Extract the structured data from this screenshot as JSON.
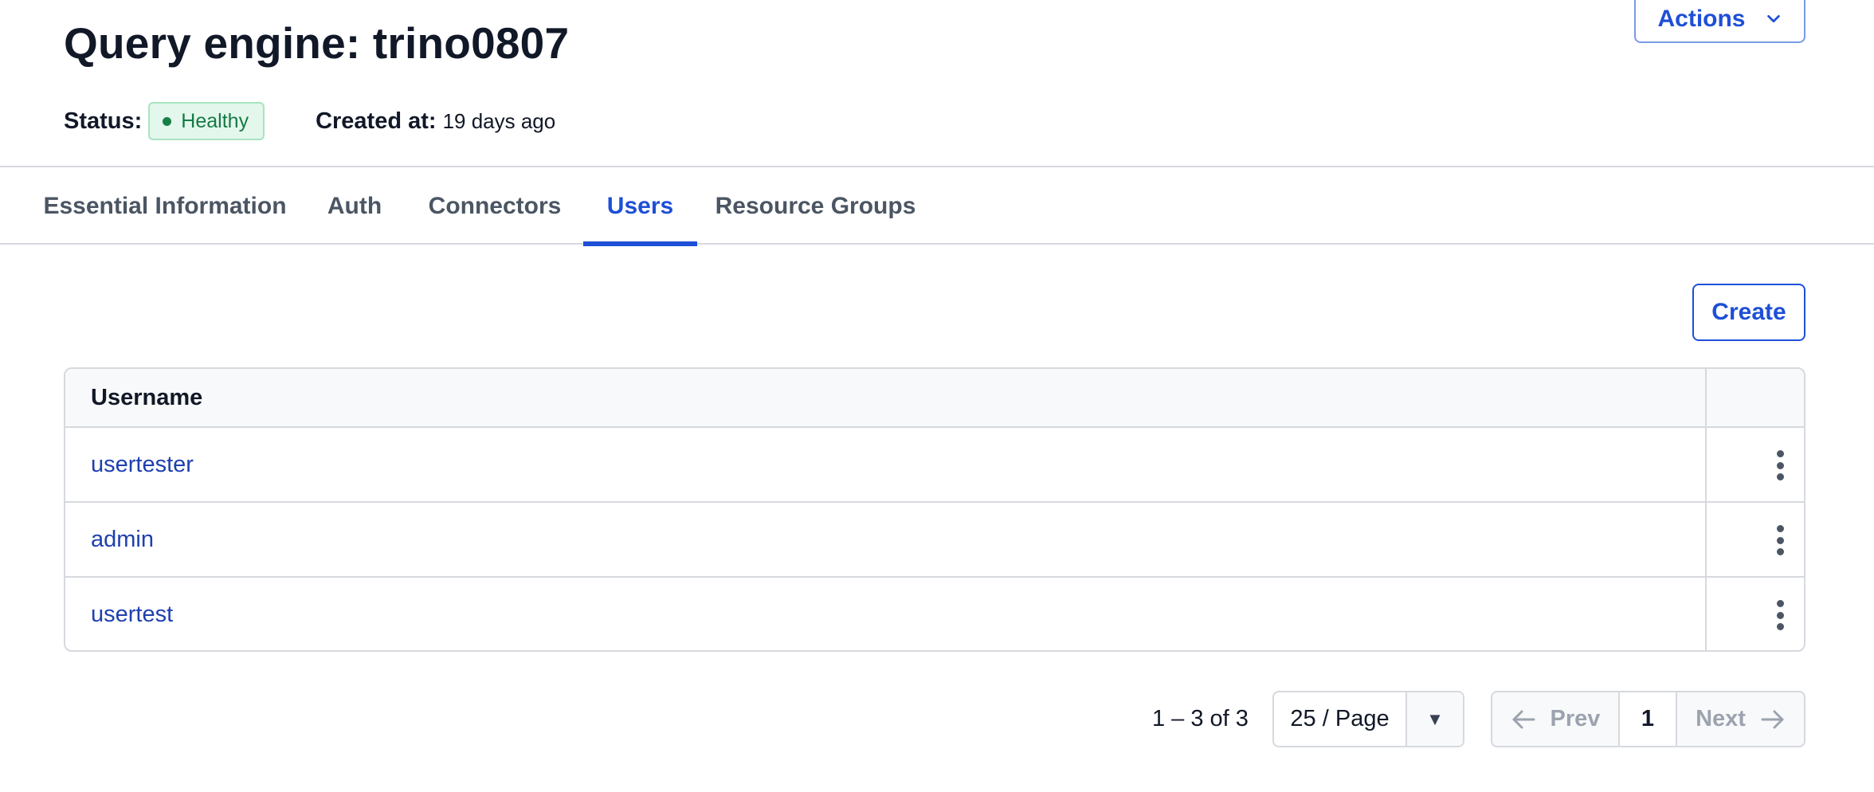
{
  "header": {
    "title": "Query engine: trino0807",
    "actions_label": "Actions",
    "status_label": "Status:",
    "status_value": "Healthy",
    "created_label": "Created at:",
    "created_value": "19 days ago"
  },
  "tabs": [
    {
      "label": "Essential Information",
      "active": false
    },
    {
      "label": "Auth",
      "active": false
    },
    {
      "label": "Connectors",
      "active": false
    },
    {
      "label": "Users",
      "active": true
    },
    {
      "label": "Resource Groups",
      "active": false
    }
  ],
  "toolbar": {
    "create_label": "Create"
  },
  "table": {
    "columns": [
      "Username"
    ],
    "rows": [
      {
        "username": "usertester"
      },
      {
        "username": "admin"
      },
      {
        "username": "usertest"
      }
    ]
  },
  "pagination": {
    "range_text": "1 – 3 of 3",
    "page_size": "25 / Page",
    "prev_label": "Prev",
    "current_page": "1",
    "next_label": "Next"
  },
  "colors": {
    "accent": "#1e4fd6",
    "status_success": "#157a44",
    "link": "#1e40af"
  },
  "icons": {
    "actions": "chevron-down-icon",
    "row_menu": "kebab-menu-icon",
    "page_size_toggle": "caret-down-icon",
    "prev": "arrow-left-icon",
    "next": "arrow-right-icon",
    "status": "status-dot-icon"
  }
}
